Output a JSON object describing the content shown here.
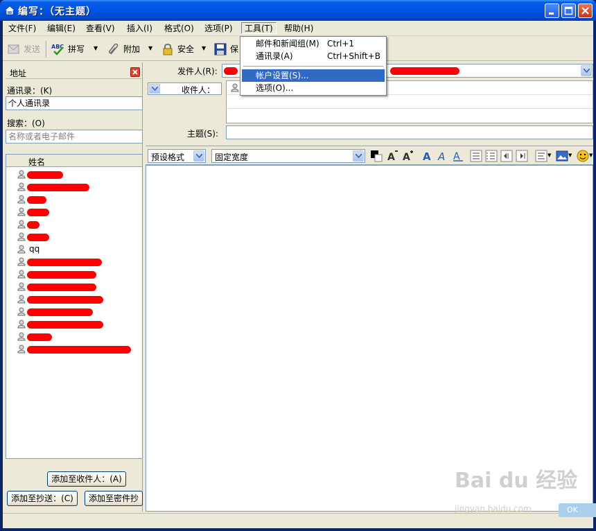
{
  "window": {
    "title": "编写：（无主题）"
  },
  "menubar": {
    "items": [
      "文件(F)",
      "编辑(E)",
      "查看(V)",
      "插入(I)",
      "格式(O)",
      "选项(P)",
      "工具(T)",
      "帮助(H)"
    ]
  },
  "toolbar": {
    "send": "发送",
    "spell": "拼写",
    "attach": "附加",
    "security": "安全",
    "save": "保"
  },
  "tools_menu": {
    "items": [
      {
        "label": "邮件和新闻组(M)",
        "shortcut": "Ctrl+1"
      },
      {
        "label": "通讯录(A)",
        "shortcut": "Ctrl+Shift+B"
      },
      {
        "label": "帐户设置(S)...",
        "shortcut": ""
      },
      {
        "label": "选项(O)...",
        "shortcut": ""
      }
    ]
  },
  "left_pane": {
    "title": "地址",
    "addressbook_label": "通讯录：(K)",
    "addressbook_value": "个人通讯录",
    "search_label": "搜索：(O)",
    "search_placeholder": "名称或者电子邮件",
    "column_name": "姓名",
    "contacts": [
      "",
      "",
      "",
      "",
      "",
      "",
      "qq",
      "",
      "",
      "",
      "",
      "",
      "",
      "",
      ""
    ],
    "add_to_label": "添加至收件人：(A)",
    "add_cc_label": "添加至抄送：(C)",
    "add_bcc_label": "添加至密件抄"
  },
  "header": {
    "from_label": "发件人(R):",
    "to_type": "收件人：",
    "subject_label": "主题(S):"
  },
  "format_bar": {
    "paragraph_style": "预设格式",
    "font": "固定宽度"
  },
  "watermark": {
    "main": "Bai du 经验",
    "sub": "jingyan.baidu.com",
    "tag": "OK"
  }
}
